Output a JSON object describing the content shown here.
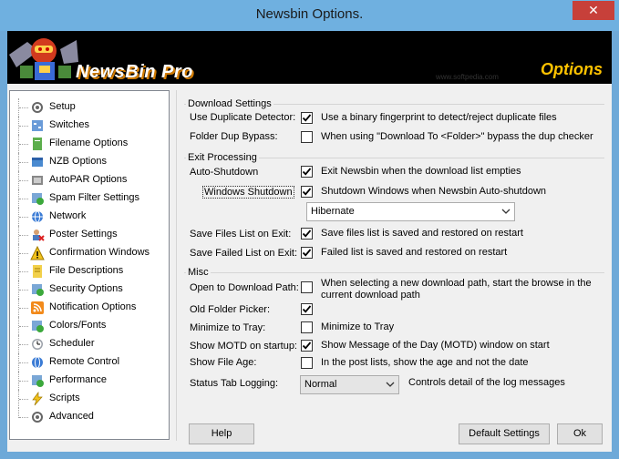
{
  "window": {
    "title": "Newsbin Options.",
    "close_glyph": "✕"
  },
  "banner": {
    "brand": "NewsBin Pro",
    "options_title": "Options",
    "watermark": "www.softpedia.com"
  },
  "nav": {
    "items": [
      {
        "label": "Setup",
        "icon": "gear-icon"
      },
      {
        "label": "Switches",
        "icon": "switches-icon"
      },
      {
        "label": "Filename Options",
        "icon": "filename-icon"
      },
      {
        "label": "NZB Options",
        "icon": "nzb-icon"
      },
      {
        "label": "AutoPAR Options",
        "icon": "autopar-icon"
      },
      {
        "label": "Spam Filter Settings",
        "icon": "spam-filter-icon"
      },
      {
        "label": "Network",
        "icon": "network-icon"
      },
      {
        "label": "Poster Settings",
        "icon": "poster-icon"
      },
      {
        "label": "Confirmation Windows",
        "icon": "warning-icon"
      },
      {
        "label": "File Descriptions",
        "icon": "file-descriptions-icon"
      },
      {
        "label": "Security Options",
        "icon": "security-icon"
      },
      {
        "label": "Notification Options",
        "icon": "rss-icon"
      },
      {
        "label": "Colors/Fonts",
        "icon": "colors-icon"
      },
      {
        "label": "Scheduler",
        "icon": "scheduler-icon"
      },
      {
        "label": "Remote Control",
        "icon": "remote-control-icon"
      },
      {
        "label": "Performance",
        "icon": "performance-icon"
      },
      {
        "label": "Scripts",
        "icon": "scripts-icon"
      },
      {
        "label": "Advanced",
        "icon": "advanced-icon"
      }
    ],
    "selected": "Advanced"
  },
  "download_settings": {
    "title": "Download Settings",
    "dup_detector": {
      "label": "Use Duplicate Detector:",
      "checked": true,
      "desc": "Use a binary fingerprint to detect/reject duplicate files"
    },
    "dup_bypass": {
      "label": "Folder Dup Bypass:",
      "checked": false,
      "desc": "When using \"Download To <Folder>\" bypass the dup checker"
    }
  },
  "exit_processing": {
    "title": "Exit Processing",
    "auto_shutdown": {
      "label": "Auto-Shutdown",
      "checked": true,
      "desc": "Exit Newsbin when the download list empties"
    },
    "windows_shutdown": {
      "label": "Windows Shutdown",
      "checked": true,
      "desc": "Shutdown Windows when Newsbin Auto-shutdown"
    },
    "shutdown_mode": {
      "value": "Hibernate"
    },
    "save_files_list": {
      "label": "Save Files List on Exit:",
      "checked": true,
      "desc": "Save files list is saved and restored on restart"
    },
    "save_failed_list": {
      "label": "Save Failed List on Exit:",
      "checked": true,
      "desc": "Failed list is saved and restored on restart"
    }
  },
  "misc": {
    "title": "Misc",
    "open_download_path": {
      "label": "Open to Download Path:",
      "checked": false,
      "desc": "When selecting a new download path, start the browse in the current download path"
    },
    "old_folder_picker": {
      "label": "Old Folder Picker:",
      "checked": true
    },
    "minimize_to_tray": {
      "label": "Minimize to Tray:",
      "checked": false,
      "desc": "Minimize to Tray"
    },
    "show_motd": {
      "label": "Show MOTD on startup:",
      "checked": true,
      "desc": "Show Message of the Day (MOTD) window on start"
    },
    "show_file_age": {
      "label": "Show File Age:",
      "checked": false,
      "desc": "In the post lists, show the age and not the date"
    },
    "status_tab_logging": {
      "label": "Status Tab Logging:",
      "value": "Normal",
      "desc": "Controls detail of the log messages"
    }
  },
  "buttons": {
    "help": "Help",
    "default_settings": "Default Settings",
    "ok": "Ok"
  }
}
